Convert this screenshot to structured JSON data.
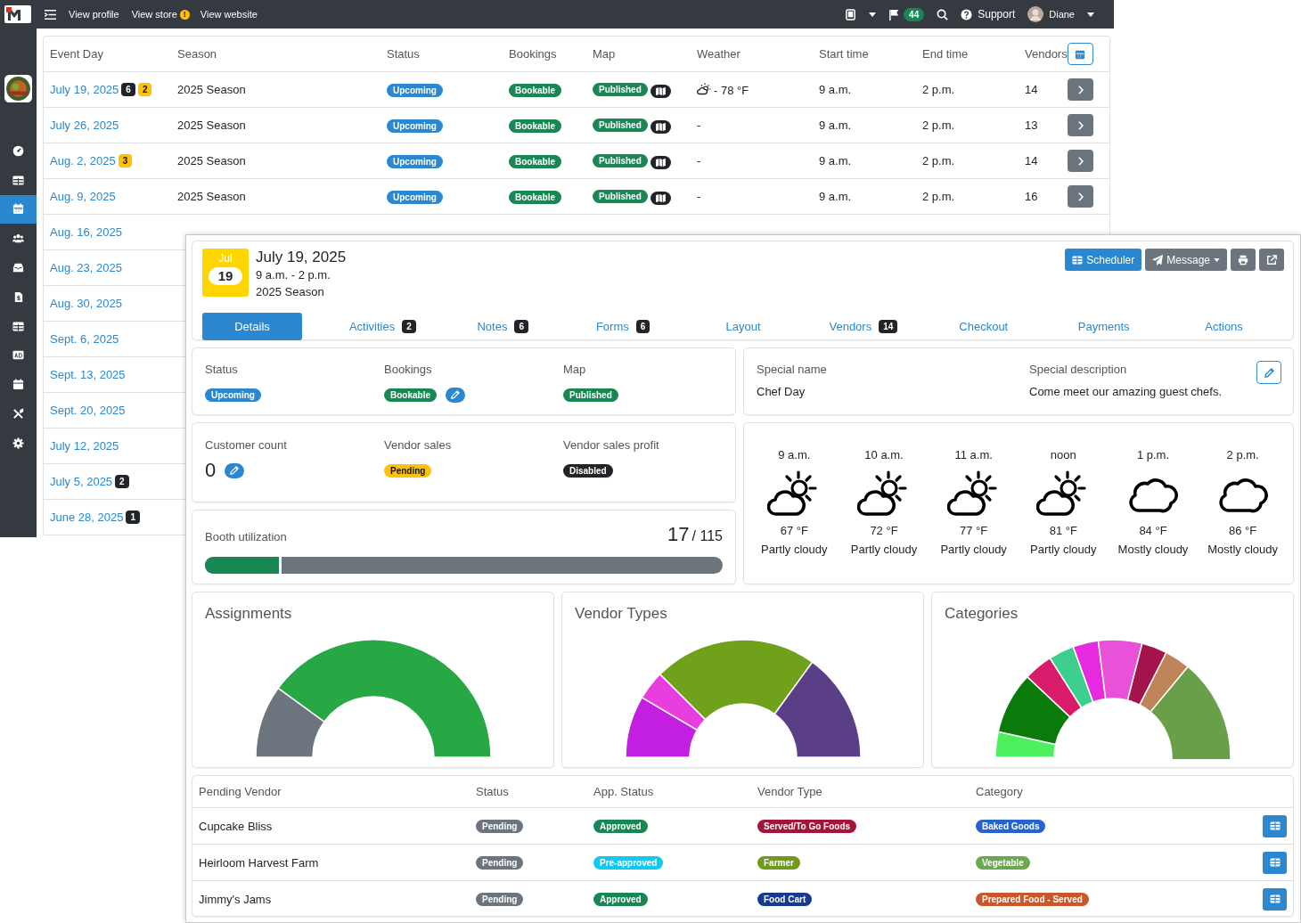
{
  "topbar": {
    "links": [
      "View profile",
      "View store",
      "View website"
    ],
    "store_alert": "!",
    "flag_count": "44",
    "support": "Support",
    "user": "Diane"
  },
  "sidebar": {
    "items": [
      {
        "kind": "dashboard",
        "selected": false
      },
      {
        "kind": "table",
        "selected": false
      },
      {
        "kind": "calendar",
        "selected": true
      },
      {
        "kind": "users",
        "selected": false
      },
      {
        "kind": "inbox",
        "selected": false
      },
      {
        "kind": "invoice",
        "selected": false
      },
      {
        "kind": "table",
        "selected": false
      },
      {
        "kind": "ad",
        "selected": false
      },
      {
        "kind": "calendar",
        "selected": false
      },
      {
        "kind": "tools",
        "selected": false
      },
      {
        "kind": "settings",
        "selected": false
      }
    ]
  },
  "events_table": {
    "columns": [
      "Event Day",
      "Season",
      "Status",
      "Bookings",
      "Map",
      "Weather",
      "Start time",
      "End time",
      "Vendors"
    ],
    "rows": [
      {
        "day": "July 19, 2025",
        "badges": [
          {
            "text": "6",
            "color": "#212529"
          },
          {
            "text": "2",
            "color": "#ffc107"
          }
        ],
        "season": "2025 Season",
        "status": {
          "text": "Upcoming",
          "color": "#2a87d0"
        },
        "bookings": {
          "text": "Bookable",
          "color": "#198754"
        },
        "map": {
          "text": "Published",
          "color": "#198754"
        },
        "weather": {
          "kind": "partly-cloudy",
          "text": "- 78 °F"
        },
        "start": "9 a.m.",
        "end": "2 p.m.",
        "vendors": "14"
      },
      {
        "day": "July 26, 2025",
        "badges": [],
        "season": "2025 Season",
        "status": {
          "text": "Upcoming",
          "color": "#2a87d0"
        },
        "bookings": {
          "text": "Bookable",
          "color": "#198754"
        },
        "map": {
          "text": "Published",
          "color": "#198754"
        },
        "weather": {
          "kind": "none",
          "text": "-"
        },
        "start": "9 a.m.",
        "end": "2 p.m.",
        "vendors": "13"
      },
      {
        "day": "Aug. 2, 2025",
        "badges": [
          {
            "text": "3",
            "color": "#ffc107"
          }
        ],
        "season": "2025 Season",
        "status": {
          "text": "Upcoming",
          "color": "#2a87d0"
        },
        "bookings": {
          "text": "Bookable",
          "color": "#198754"
        },
        "map": {
          "text": "Published",
          "color": "#198754"
        },
        "weather": {
          "kind": "none",
          "text": "-"
        },
        "start": "9 a.m.",
        "end": "2 p.m.",
        "vendors": "14"
      },
      {
        "day": "Aug. 9, 2025",
        "badges": [],
        "season": "2025 Season",
        "status": {
          "text": "Upcoming",
          "color": "#2a87d0"
        },
        "bookings": {
          "text": "Bookable",
          "color": "#198754"
        },
        "map": {
          "text": "Published",
          "color": "#198754"
        },
        "weather": {
          "kind": "none",
          "text": "-"
        },
        "start": "9 a.m.",
        "end": "2 p.m.",
        "vendors": "16"
      },
      {
        "day": "Aug. 16, 2025",
        "badges": []
      },
      {
        "day": "Aug. 23, 2025",
        "badges": []
      },
      {
        "day": "Aug. 30, 2025",
        "badges": []
      },
      {
        "day": "Sept. 6, 2025",
        "badges": []
      },
      {
        "day": "Sept. 13, 2025",
        "badges": []
      },
      {
        "day": "Sept. 20, 2025",
        "badges": []
      },
      {
        "day": "July 12, 2025",
        "badges": []
      },
      {
        "day": "July 5, 2025",
        "badges": [
          {
            "text": "2",
            "color": "#212529"
          }
        ]
      },
      {
        "day": "June 28, 2025",
        "badges": [
          {
            "text": "1",
            "color": "#212529"
          }
        ]
      }
    ]
  },
  "detail": {
    "month": "Jul",
    "day": "19",
    "title": "July 19, 2025",
    "time": "9 a.m. - 2 p.m.",
    "season": "2025 Season",
    "actions": [
      {
        "kind": "scheduler",
        "label": "Scheduler"
      },
      {
        "kind": "message",
        "label": "Message"
      },
      {
        "kind": "print"
      },
      {
        "kind": "external"
      }
    ],
    "tabs": [
      {
        "label": "Details",
        "selected": true
      },
      {
        "label": "Activities",
        "count": "2",
        "selected": false
      },
      {
        "label": "Notes",
        "count": "6",
        "selected": false
      },
      {
        "label": "Forms",
        "count": "6",
        "selected": false
      },
      {
        "label": "Layout",
        "selected": false
      },
      {
        "label": "Vendors",
        "count": "14",
        "selected": false
      },
      {
        "label": "Checkout",
        "selected": false
      },
      {
        "label": "Payments",
        "selected": false
      },
      {
        "label": "Actions",
        "selected": false
      }
    ],
    "status_fields": [
      {
        "label": "Status",
        "badge": {
          "text": "Upcoming",
          "color": "#2a87d0"
        },
        "editable": false
      },
      {
        "label": "Bookings",
        "badge": {
          "text": "Bookable",
          "color": "#198754"
        },
        "editable": true
      },
      {
        "label": "Map",
        "badge": {
          "text": "Published",
          "color": "#198754"
        },
        "editable": false
      }
    ],
    "special": {
      "name_label": "Special name",
      "name": "Chef Day",
      "description_label": "Special description",
      "description": "Come meet our amazing guest chefs."
    },
    "customer_count": {
      "label": "Customer count",
      "value": "0"
    },
    "sales_fields": [
      {
        "label": "Vendor sales",
        "badge": {
          "text": "Pending",
          "color": "#ffc107"
        }
      },
      {
        "label": "Vendor sales profit",
        "badge": {
          "text": "Disabled",
          "color": "#212529"
        }
      }
    ],
    "booth": {
      "label": "Booth utilization",
      "used": "17",
      "total": "/ 115",
      "level": 0.148
    },
    "weather": [
      {
        "time": "9 a.m.",
        "kind": "partly-cloudy",
        "temp": "67 °F",
        "condition": "Partly cloudy"
      },
      {
        "time": "10 a.m.",
        "kind": "partly-cloudy",
        "temp": "72 °F",
        "condition": "Partly cloudy"
      },
      {
        "time": "11 a.m.",
        "kind": "partly-cloudy",
        "temp": "77 °F",
        "condition": "Partly cloudy"
      },
      {
        "time": "noon",
        "kind": "partly-cloudy",
        "temp": "81 °F",
        "condition": "Partly cloudy"
      },
      {
        "time": "1 p.m.",
        "kind": "cloudy",
        "temp": "84 °F",
        "condition": "Mostly cloudy"
      },
      {
        "time": "2 p.m.",
        "kind": "cloudy",
        "temp": "86 °F",
        "condition": "Mostly cloudy"
      }
    ],
    "charts": [
      {
        "title": "Assignments"
      },
      {
        "title": "Vendor Types"
      },
      {
        "title": "Categories"
      }
    ],
    "vendors_table": {
      "columns": [
        "Pending Vendor",
        "Status",
        "App. Status",
        "Vendor Type",
        "Category"
      ],
      "rows": [
        {
          "name": "Cupcake Bliss",
          "status": {
            "text": "Pending",
            "color": "#6c757d"
          },
          "app_status": {
            "text": "Approved",
            "color": "#198754"
          },
          "vendor_type": {
            "text": "Served/To Go Foods",
            "color": "#a3143c"
          },
          "category": {
            "text": "Baked Goods",
            "color": "#2563d0"
          }
        },
        {
          "name": "Heirloom Harvest Farm",
          "status": {
            "text": "Pending",
            "color": "#6c757d"
          },
          "app_status": {
            "text": "Pre-approved",
            "color": "#0dcaf0"
          },
          "vendor_type": {
            "text": "Farmer",
            "color": "#6f9a1a"
          },
          "category": {
            "text": "Vegetable",
            "color": "#6aa84f"
          }
        },
        {
          "name": "Jimmy's Jams",
          "status": {
            "text": "Pending",
            "color": "#6c757d"
          },
          "app_status": {
            "text": "Approved",
            "color": "#198754"
          },
          "vendor_type": {
            "text": "Food Cart",
            "color": "#163a94"
          },
          "category": {
            "text": "Prepared Food - Served",
            "color": "#c8572c"
          }
        }
      ]
    }
  }
}
